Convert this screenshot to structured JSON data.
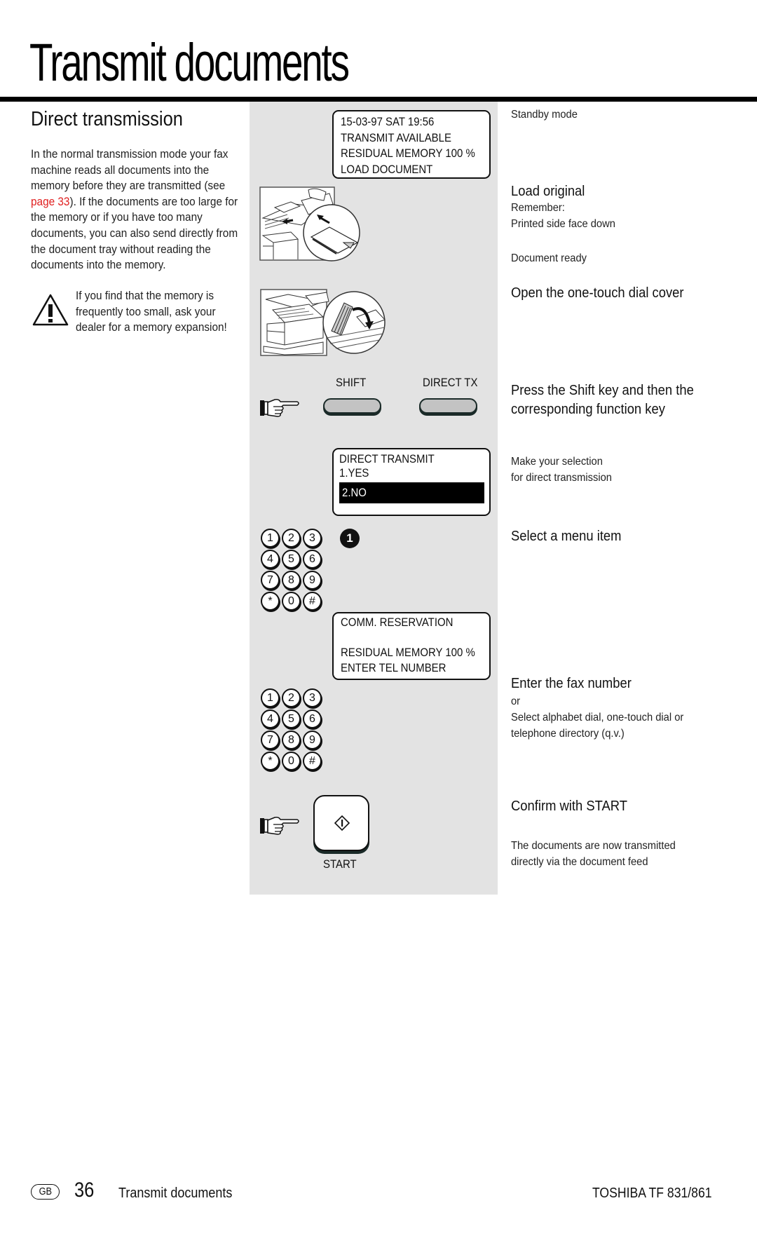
{
  "page": {
    "title": "Transmit documents",
    "section_heading": "Direct  transmission"
  },
  "intro": {
    "text_before_link": "In the normal transmission mode your fax machine reads all documents into the memory before they are transmitted (see ",
    "link_text": "page 33",
    "text_after_link": "). If the documents are too large for the memory or if you have too many documents, you can also send directly from the document tray without reading the documents into the memory.",
    "link_color": "#e02020"
  },
  "warning": {
    "icon": "warning-triangle-icon",
    "text": "If you find that the memory is frequently too small, ask your dealer for a memory expansion!"
  },
  "lcd_standby": {
    "lines": [
      "15-03-97    SAT    19:56",
      "TRANSMIT AVAILABLE",
      "RESIDUAL MEMORY 100 %",
      "LOAD DOCUMENT"
    ]
  },
  "lcd_direct": {
    "title": "DIRECT TRANSMIT",
    "options": [
      "1.YES",
      "2.NO"
    ],
    "selected_option": "2.NO"
  },
  "lcd_comm": {
    "lines": [
      "COMM. RESERVATION",
      "",
      "RESIDUAL MEMORY 100 %",
      "ENTER TEL NUMBER"
    ]
  },
  "keys": {
    "shift_label": "SHIFT",
    "direct_tx_label": "DIRECT TX",
    "start_label": "START",
    "menu_badge": "1",
    "keypad": [
      "1",
      "2",
      "3",
      "4",
      "5",
      "6",
      "7",
      "8",
      "9",
      "*",
      "0",
      "#"
    ]
  },
  "steps": {
    "standby": "Standby mode",
    "load_title": "Load original",
    "load_remember": "Remember:",
    "load_face": "Printed side face down",
    "doc_ready": "Document ready",
    "open_cover": "Open the one-touch dial cover",
    "press_shift": [
      "Press the Shift key and then the",
      "corresponding function key"
    ],
    "make_selection": [
      "Make your selection",
      "for direct transmission"
    ],
    "select_item": "Select a menu item",
    "enter_fax": "Enter the fax number",
    "or": "or",
    "select_alpha": [
      "Select alphabet dial, one-touch dial or",
      "telephone directory (q.v.)"
    ],
    "confirm": "Confirm with START",
    "transmitted": [
      "The documents are now transmitted",
      "directly via the document feed"
    ]
  },
  "footer": {
    "country": "GB",
    "page_number": "36",
    "section": "Transmit documents",
    "brand": "TOSHIBA  TF 831/861"
  }
}
